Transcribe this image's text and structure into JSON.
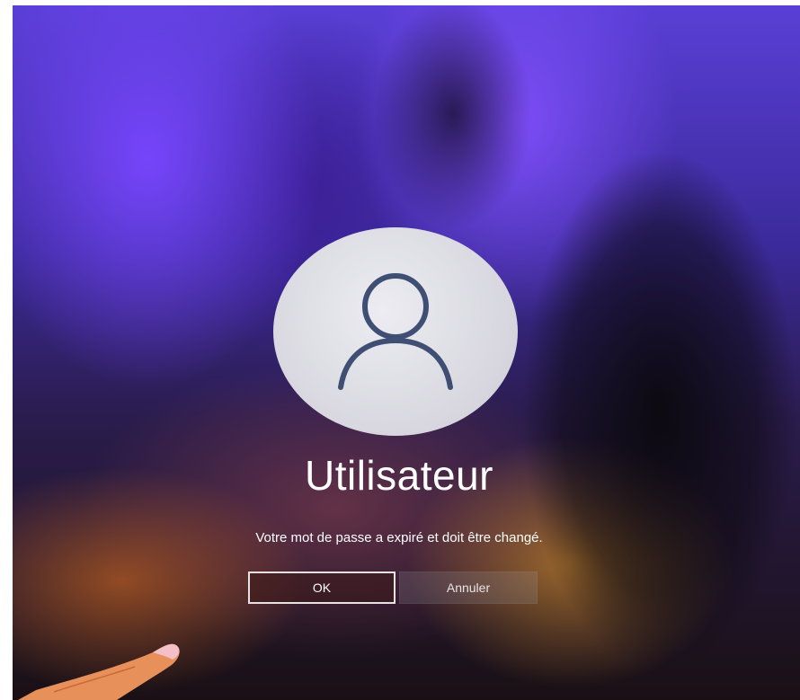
{
  "login": {
    "username": "Utilisateur",
    "message": "Votre mot de passe a expiré et doit être changé.",
    "ok_label": "OK",
    "cancel_label": "Annuler"
  },
  "colors": {
    "avatar_bg": "#e2e1e8",
    "avatar_icon": "#3f4f74",
    "text": "#ffffff",
    "ok_border": "#e8e2e2"
  },
  "icons": {
    "avatar": "user-icon"
  }
}
